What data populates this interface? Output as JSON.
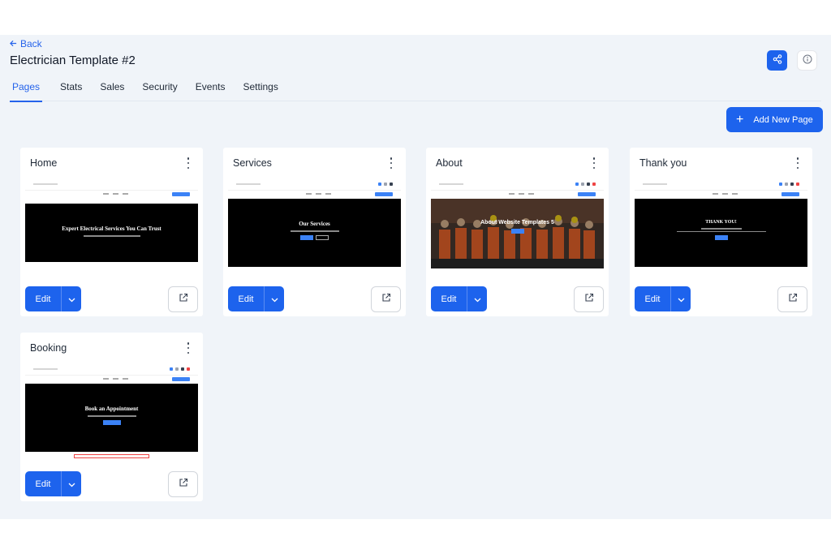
{
  "header": {
    "back_label": "Back",
    "title": "Electrician Template #2"
  },
  "tabs": [
    "Pages",
    "Stats",
    "Sales",
    "Security",
    "Events",
    "Settings"
  ],
  "active_tab": "Pages",
  "add_page_label": "Add New Page",
  "colors": {
    "accent": "#1d63ed",
    "background": "#f0f4f9"
  },
  "edit_label": "Edit",
  "pages": [
    {
      "title": "Home",
      "hero": "Expert Electrical Services You Can Trust"
    },
    {
      "title": "Services",
      "hero": "Our Services"
    },
    {
      "title": "About",
      "hero": "About Website Templates 5"
    },
    {
      "title": "Thank you",
      "hero": "THANK YOU!"
    },
    {
      "title": "Booking",
      "hero": "Book an Appointment"
    }
  ]
}
